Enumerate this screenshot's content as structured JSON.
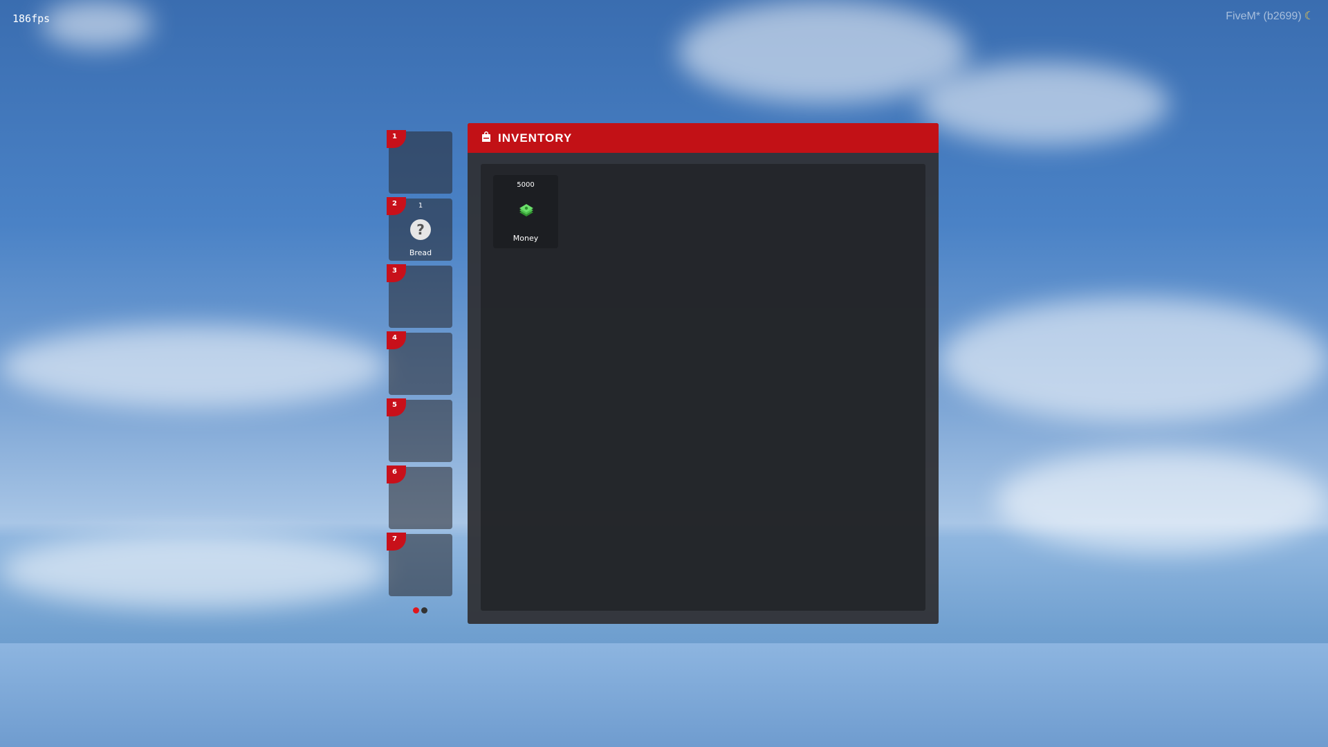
{
  "overlay": {
    "fps": "186fps",
    "build": "FiveM* (b2699)"
  },
  "hotbar": {
    "slots": [
      {
        "number": "1",
        "count": "",
        "label": ""
      },
      {
        "number": "2",
        "count": "1",
        "label": "Bread",
        "icon": "question-icon"
      },
      {
        "number": "3",
        "count": "",
        "label": ""
      },
      {
        "number": "4",
        "count": "",
        "label": ""
      },
      {
        "number": "5",
        "count": "",
        "label": ""
      },
      {
        "number": "6",
        "count": "",
        "label": ""
      },
      {
        "number": "7",
        "count": "",
        "label": ""
      }
    ],
    "pages": 2,
    "active_page": 1
  },
  "inventory": {
    "title": "INVENTORY",
    "header_icon": "backpack-icon",
    "accent": "#c21116",
    "items": [
      {
        "count": "5000",
        "label": "Money",
        "icon": "money-icon"
      }
    ]
  }
}
